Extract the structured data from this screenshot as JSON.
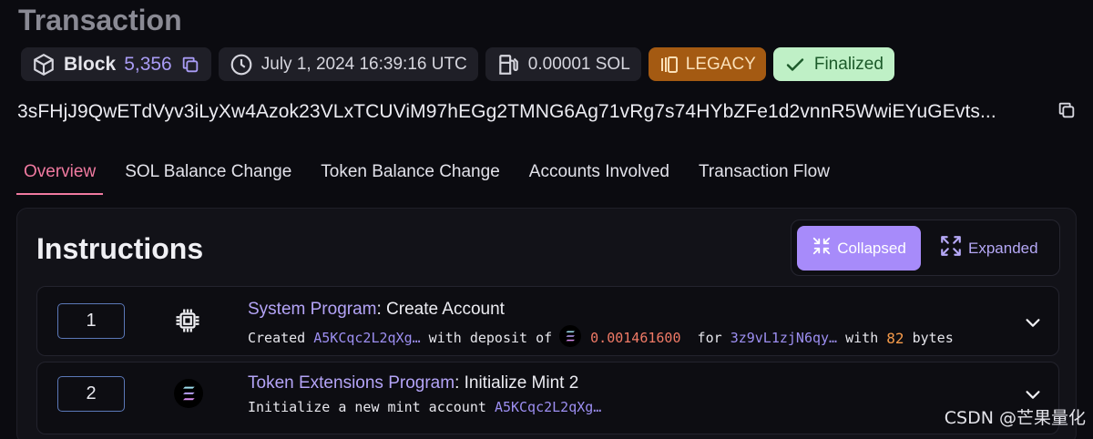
{
  "header": {
    "title": "Transaction"
  },
  "badges": {
    "block_label": "Block",
    "block_number": "5,356",
    "timestamp": "July 1, 2024 16:39:16 UTC",
    "fee": "0.00001 SOL",
    "version": "LEGACY",
    "status": "Finalized",
    "colors": {
      "legacy_bg": "#a45a12",
      "finalized_bg": "#bff0c6",
      "accent": "#a78bfa"
    }
  },
  "signature": "3sFHjJ9QwETdVyv3iLyXw4Azok23VLxTCUViM97hEGg2TMNG6Ag71vRg7s74HYbZFe1d2vnnR5WwiEYuGEvts...",
  "tabs": [
    {
      "label": "Overview",
      "active": true
    },
    {
      "label": "SOL Balance Change",
      "active": false
    },
    {
      "label": "Token Balance Change",
      "active": false
    },
    {
      "label": "Accounts Involved",
      "active": false
    },
    {
      "label": "Transaction Flow",
      "active": false
    }
  ],
  "instructions": {
    "title": "Instructions",
    "view_toggle": {
      "collapsed_label": "Collapsed",
      "expanded_label": "Expanded",
      "selected": "Collapsed"
    },
    "items": [
      {
        "index": "1",
        "program": "System Program",
        "action": ": Create Account",
        "icon": "cpu-chip-icon",
        "desc": {
          "prefix": "Created ",
          "account": "A5KCqc2L2qXg…",
          "mid": " with deposit of",
          "amount": "0.001461600",
          "for_text": "  for ",
          "target": "3z9vL1zjN6qy…",
          "with_text": " with ",
          "bytes": "82",
          "suffix": " bytes"
        }
      },
      {
        "index": "2",
        "program": "Token Extensions Program",
        "action": ": Initialize Mint 2",
        "icon": "solana-logo-icon",
        "desc": {
          "prefix": "Initialize a new mint account ",
          "account": "A5KCqc2L2qXg…"
        }
      }
    ]
  },
  "watermark": "CSDN @芒果量化"
}
